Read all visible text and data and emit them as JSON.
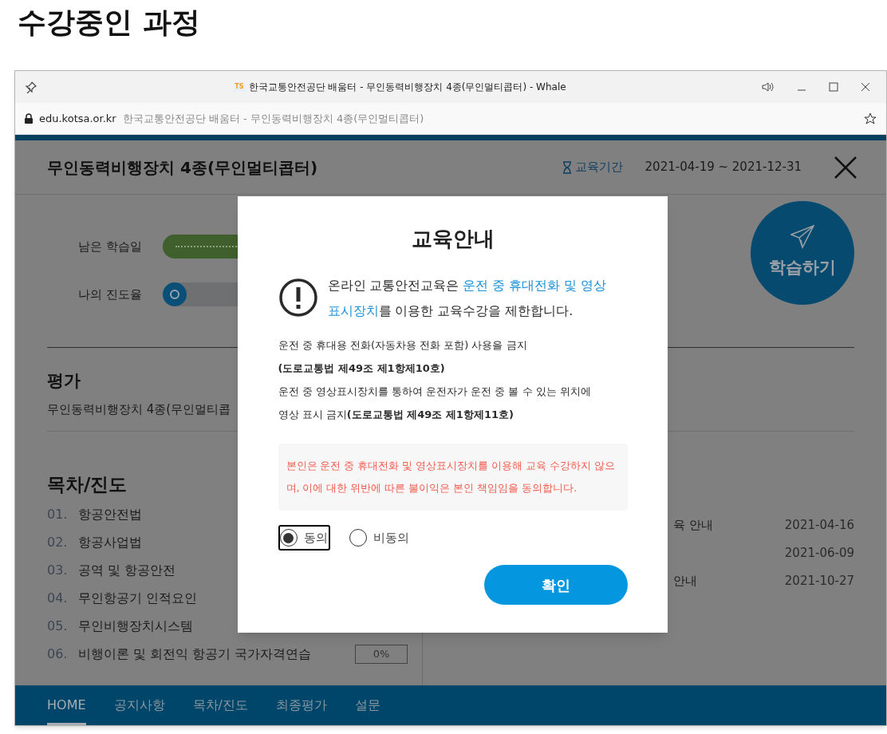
{
  "page_title": "수강중인 과정",
  "browser": {
    "favicon_text": "TS",
    "title": "한국교통안전공단 배움터 - 무인동력비행장치 4종(무인멀티콥터) - Whale",
    "url_domain": "edu.kotsa.or.kr",
    "url_title": "한국교통안전공단 배움터 - 무인동력비행장치 4종(무인멀티콥터)"
  },
  "course": {
    "title": "무인동력비행장치 4종(무인멀티콥터)",
    "period_label": "교육기간",
    "period": "2021-04-19 ~ 2021-12-31"
  },
  "meters": [
    {
      "label": "남은 학습일",
      "kind": "days"
    },
    {
      "label": "나의 진도율",
      "kind": "progress"
    }
  ],
  "study_button": "학습하기",
  "evaluation": {
    "heading": "평가",
    "item": "무인동력비행장치 4종(무인멀티콥"
  },
  "contents": {
    "heading": "목차/진도",
    "items": [
      {
        "number": "01.",
        "title": "항공안전법"
      },
      {
        "number": "02.",
        "title": "항공사업법"
      },
      {
        "number": "03.",
        "title": "공역 및 항공안전"
      },
      {
        "number": "04.",
        "title": "무인항공기 인적요인"
      },
      {
        "number": "05.",
        "title": "무인비행장치시스템"
      },
      {
        "number": "06.",
        "title": "비행이론 및 회전익 항공기 국가자격연습",
        "progress": "0%",
        "level": 0
      }
    ]
  },
  "notices": [
    {
      "title": "육 안내",
      "date": "2021-04-16"
    },
    {
      "date": "2021-06-09"
    },
    {
      "title": "안내",
      "date": "2021-10-27"
    }
  ],
  "nav": [
    {
      "label": "HOME",
      "selected": true
    },
    {
      "label": "공지사항",
      "selected": false
    },
    {
      "label": "목차/진도",
      "selected": false
    },
    {
      "label": "최종평가",
      "selected": false
    },
    {
      "label": "설문",
      "selected": false
    }
  ],
  "modal": {
    "title": "교육안내",
    "notice": [
      {
        "text": "온라인 교통안전교육은 ",
        "highlight": false
      },
      {
        "text": "운전 중 휴대전화 및 영상표시장치",
        "highlight": true
      },
      {
        "text": "를 이용한 교육수강을 제한합니다.",
        "highlight": false
      }
    ],
    "lines": [
      "운전 중 휴대용 전화(자동차용 전화 포함) 사용을 금지",
      "**(도로교통법 제49조 제1항제10호)**",
      "운전 중 영상표시장치를 통하여 운전자가 운전 중 볼 수 있는 위치에",
      "영상 표시 금지**(도로교통법 제49조 제1항제11호)**"
    ],
    "agreement": "본인은 운전 중 휴대전화 및 영상표시장치를 이용해 교육 수강하지 않으며, 이에 대한 위반에 따른 불이익은 본인 책임임을 동의합니다.",
    "options": [
      {
        "label": "동의",
        "selected": true
      },
      {
        "label": "비동의",
        "selected": false
      }
    ],
    "confirm": "확인"
  }
}
